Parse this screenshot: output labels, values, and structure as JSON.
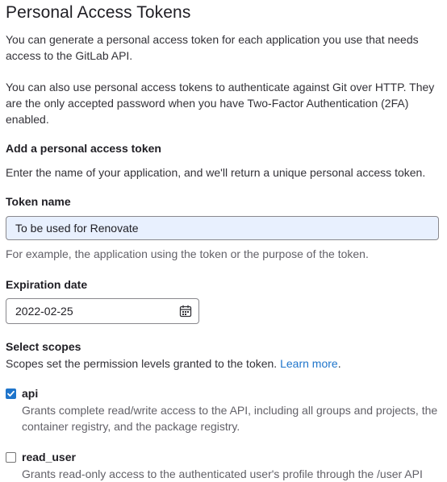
{
  "page": {
    "title": "Personal Access Tokens",
    "intro1": "You can generate a personal access token for each application you use that needs access to the GitLab API.",
    "intro2": "You can also use personal access tokens to authenticate against Git over HTTP. They are the only accepted password when you have Two-Factor Authentication (2FA) enabled."
  },
  "form": {
    "heading": "Add a personal access token",
    "description": "Enter the name of your application, and we'll return a unique personal access token.",
    "token_name": {
      "label": "Token name",
      "value": "To be used for Renovate",
      "help": "For example, the application using the token or the purpose of the token."
    },
    "expiration": {
      "label": "Expiration date",
      "value": "2022-02-25",
      "icon": "calendar-icon"
    },
    "scopes": {
      "label": "Select scopes",
      "help_prefix": "Scopes set the permission levels granted to the token.",
      "learn_more": "Learn more",
      "help_suffix": ".",
      "items": [
        {
          "name": "api",
          "checked": true,
          "description": "Grants complete read/write access to the API, including all groups and projects, the container registry, and the package registry."
        },
        {
          "name": "read_user",
          "checked": false,
          "description": "Grants read-only access to the authenticated user's profile through the /user API"
        }
      ]
    }
  },
  "colors": {
    "link": "#1f75cb",
    "checkbox_checked": "#1f75cb",
    "autofill_bg": "#e8f0fe"
  }
}
